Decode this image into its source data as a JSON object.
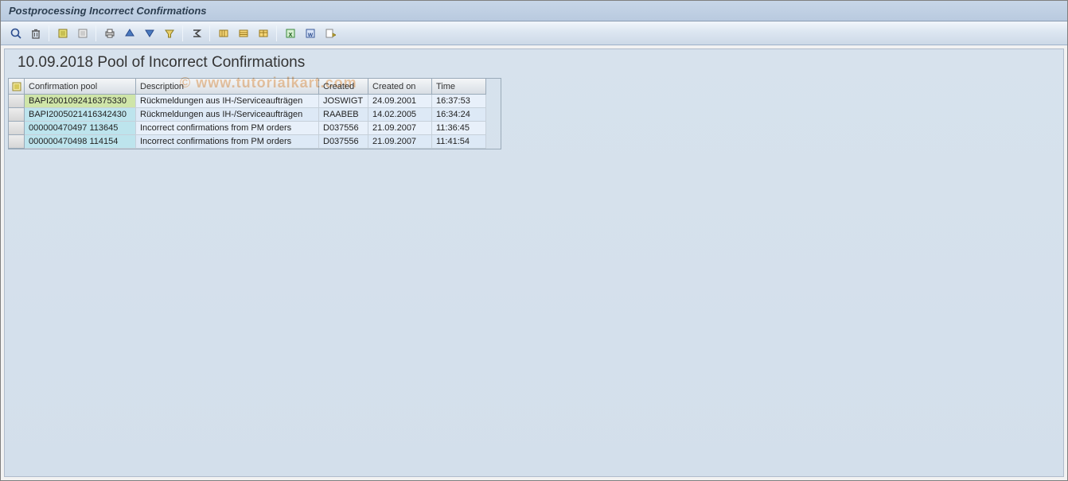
{
  "window": {
    "title": "Postprocessing Incorrect Confirmations"
  },
  "toolbar": {
    "items": [
      "details",
      "delete",
      "|",
      "select-all",
      "deselect-all",
      "|",
      "print",
      "sort-asc",
      "sort-desc",
      "filter",
      "|",
      "sum",
      "|",
      "columns",
      "subtotal",
      "layout",
      "|",
      "export-excel",
      "export-word",
      "export-local"
    ]
  },
  "section": {
    "title": "10.09.2018 Pool of Incorrect Confirmations"
  },
  "table": {
    "columns": [
      {
        "key": "pool",
        "label": "Confirmation pool"
      },
      {
        "key": "desc",
        "label": "Description"
      },
      {
        "key": "created",
        "label": "Created"
      },
      {
        "key": "createdon",
        "label": "Created on"
      },
      {
        "key": "time",
        "label": "Time"
      }
    ],
    "rows": [
      {
        "pool": "BAPI2001092416375330",
        "desc": "Rückmeldungen aus IH-/Serviceaufträgen",
        "created": "JOSWIGT",
        "createdon": "24.09.2001",
        "time": "16:37:53",
        "hl": "a"
      },
      {
        "pool": "BAPI2005021416342430",
        "desc": "Rückmeldungen aus IH-/Serviceaufträgen",
        "created": "RAABEB",
        "createdon": "14.02.2005",
        "time": "16:34:24",
        "hl": "b"
      },
      {
        "pool": "000000470497 113645",
        "desc": "Incorrect confirmations from PM orders",
        "created": "D037556",
        "createdon": "21.09.2007",
        "time": "11:36:45",
        "hl": "b"
      },
      {
        "pool": "000000470498 114154",
        "desc": "Incorrect confirmations from PM orders",
        "created": "D037556",
        "createdon": "21.09.2007",
        "time": "11:41:54",
        "hl": "b"
      }
    ]
  },
  "watermark": "© www.tutorialkart.com"
}
